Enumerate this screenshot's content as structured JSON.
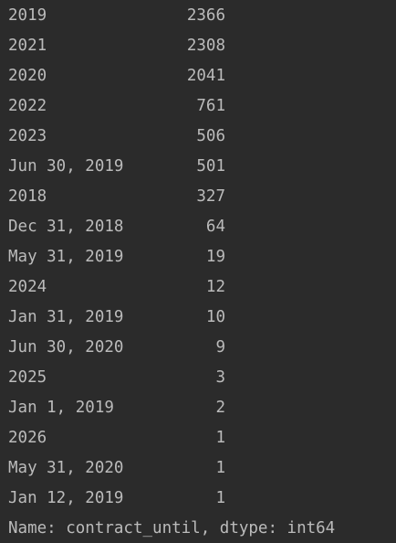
{
  "colors": {
    "background": "#2b2b2b",
    "text": "#bbbbbb"
  },
  "series": {
    "rows": [
      {
        "index": "2019",
        "count": "2366"
      },
      {
        "index": "2021",
        "count": "2308"
      },
      {
        "index": "2020",
        "count": "2041"
      },
      {
        "index": "2022",
        "count": "761"
      },
      {
        "index": "2023",
        "count": "506"
      },
      {
        "index": "Jun 30, 2019",
        "count": "501"
      },
      {
        "index": "2018",
        "count": "327"
      },
      {
        "index": "Dec 31, 2018",
        "count": "64"
      },
      {
        "index": "May 31, 2019",
        "count": "19"
      },
      {
        "index": "2024",
        "count": "12"
      },
      {
        "index": "Jan 31, 2019",
        "count": "10"
      },
      {
        "index": "Jun 30, 2020",
        "count": "9"
      },
      {
        "index": "2025",
        "count": "3"
      },
      {
        "index": "Jan 1, 2019",
        "count": "2"
      },
      {
        "index": "2026",
        "count": "1"
      },
      {
        "index": "May 31, 2020",
        "count": "1"
      },
      {
        "index": "Jan 12, 2019",
        "count": "1"
      }
    ],
    "footer": "Name: contract_until, dtype: int64"
  }
}
